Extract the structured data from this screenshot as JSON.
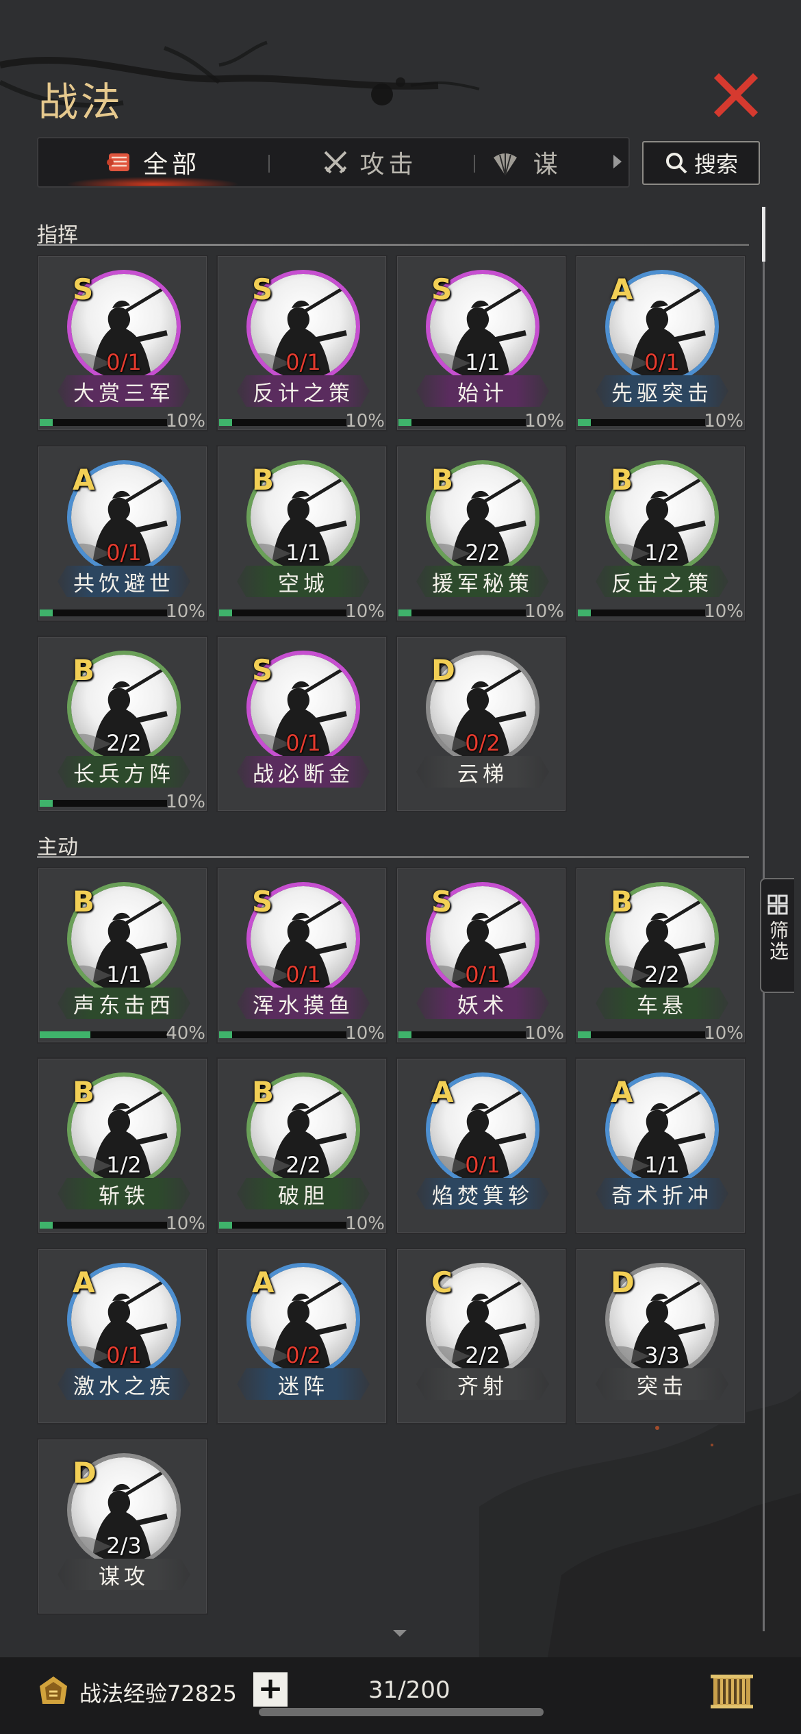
{
  "title": "战法",
  "tabs": [
    {
      "label": "全部",
      "icon": "scroll-bundle-icon",
      "active": true
    },
    {
      "label": "攻击",
      "icon": "crossed-swords-icon",
      "active": false
    },
    {
      "label": "谋",
      "icon": "fan-icon",
      "active": false
    }
  ],
  "search": {
    "label": "搜索",
    "icon": "magnifier-icon"
  },
  "filter": {
    "label": "筛选",
    "icon": "grid-icon"
  },
  "colors": {
    "S": "#c64fd0",
    "A": "#4d8fd0",
    "B": "#6aa058",
    "C": "#b9b9b9",
    "D": "#8b8b8b",
    "progress": "#3fb36b",
    "count_red": "#e63b2e",
    "close": "#d63a2f"
  },
  "sections": [
    {
      "title": "指挥",
      "cards": [
        {
          "grade": "S",
          "count": "0/1",
          "name": "大赏三军",
          "progress": "10%",
          "red": true
        },
        {
          "grade": "S",
          "count": "0/1",
          "name": "反计之策",
          "progress": "10%",
          "red": true
        },
        {
          "grade": "S",
          "count": "1/1",
          "name": "始计",
          "progress": "10%",
          "red": false
        },
        {
          "grade": "A",
          "count": "0/1",
          "name": "先驱突击",
          "progress": "10%",
          "red": true
        },
        {
          "grade": "A",
          "count": "0/1",
          "name": "共饮避世",
          "progress": "10%",
          "red": true
        },
        {
          "grade": "B",
          "count": "1/1",
          "name": "空城",
          "progress": "10%",
          "red": false
        },
        {
          "grade": "B",
          "count": "2/2",
          "name": "援军秘策",
          "progress": "10%",
          "red": false
        },
        {
          "grade": "B",
          "count": "1/2",
          "name": "反击之策",
          "progress": "10%",
          "red": false
        },
        {
          "grade": "B",
          "count": "2/2",
          "name": "长兵方阵",
          "progress": "10%",
          "red": false
        },
        {
          "grade": "S",
          "count": "0/1",
          "name": "战必断金",
          "progress": "",
          "red": true
        },
        {
          "grade": "D",
          "count": "0/2",
          "name": "云梯",
          "progress": "",
          "red": true
        }
      ]
    },
    {
      "title": "主动",
      "cards": [
        {
          "grade": "B",
          "count": "1/1",
          "name": "声东击西",
          "progress": "40%",
          "red": false
        },
        {
          "grade": "S",
          "count": "0/1",
          "name": "浑水摸鱼",
          "progress": "10%",
          "red": true
        },
        {
          "grade": "S",
          "count": "0/1",
          "name": "妖术",
          "progress": "10%",
          "red": true
        },
        {
          "grade": "B",
          "count": "2/2",
          "name": "车悬",
          "progress": "10%",
          "red": false
        },
        {
          "grade": "B",
          "count": "1/2",
          "name": "斩铁",
          "progress": "10%",
          "red": false
        },
        {
          "grade": "B",
          "count": "2/2",
          "name": "破胆",
          "progress": "10%",
          "red": false
        },
        {
          "grade": "A",
          "count": "0/1",
          "name": "焰焚箕轸",
          "progress": "",
          "red": true
        },
        {
          "grade": "A",
          "count": "1/1",
          "name": "奇术折冲",
          "progress": "",
          "red": false
        },
        {
          "grade": "A",
          "count": "0/1",
          "name": "激水之疾",
          "progress": "",
          "red": true
        },
        {
          "grade": "A",
          "count": "0/2",
          "name": "迷阵",
          "progress": "",
          "red": true
        },
        {
          "grade": "C",
          "count": "2/2",
          "name": "齐射",
          "progress": "",
          "red": false
        },
        {
          "grade": "D",
          "count": "3/3",
          "name": "突击",
          "progress": "",
          "red": false
        },
        {
          "grade": "D",
          "count": "2/3",
          "name": "谋攻",
          "progress": "",
          "red": false
        }
      ]
    }
  ],
  "footer": {
    "exp_label": "战法经验",
    "exp_value": "72825",
    "add_label": "+",
    "capacity": "31/200"
  }
}
